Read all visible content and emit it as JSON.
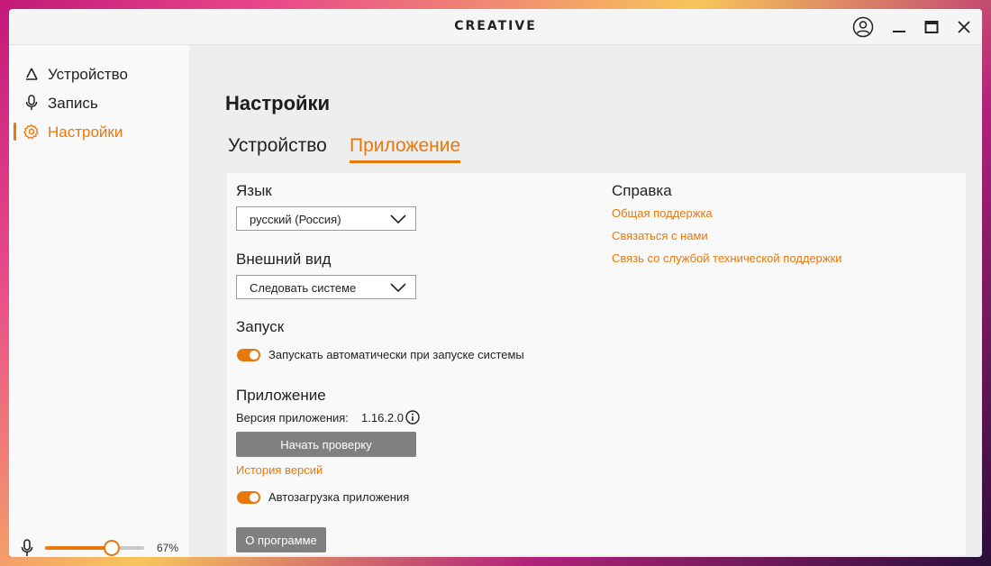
{
  "window": {
    "brand": "CREATIVE"
  },
  "sidebar": {
    "items": [
      {
        "label": "Устройство",
        "icon": "device-icon"
      },
      {
        "label": "Запись",
        "icon": "microphone-icon"
      },
      {
        "label": "Настройки",
        "icon": "gear-icon",
        "active": true
      }
    ],
    "volume": {
      "percent_label": "67%",
      "value": 0.67
    }
  },
  "main": {
    "title": "Настройки",
    "tabs": [
      {
        "label": "Устройство",
        "active": false
      },
      {
        "label": "Приложение",
        "active": true
      }
    ]
  },
  "settings": {
    "language": {
      "title": "Язык",
      "value": "русский (Россия)"
    },
    "appearance": {
      "title": "Внешний вид",
      "value": "Следовать системе"
    },
    "startup": {
      "title": "Запуск",
      "autostart_label": "Запускать автоматически при запуске системы",
      "autostart_on": true
    },
    "application": {
      "title": "Приложение",
      "version_label": "Версия приложения:",
      "version_value": "1.16.2.0",
      "check_button": "Начать проверку",
      "history_link": "История версий",
      "autoupdate_label": "Автозагрузка приложения",
      "autoupdate_on": true,
      "about_button": "О программе"
    },
    "help": {
      "title": "Справка",
      "links": [
        "Общая поддержка",
        "Связаться с нами",
        "Связь со службой технической поддержки"
      ]
    }
  },
  "colors": {
    "accent": "#e8780c",
    "button_gray": "#808080"
  }
}
